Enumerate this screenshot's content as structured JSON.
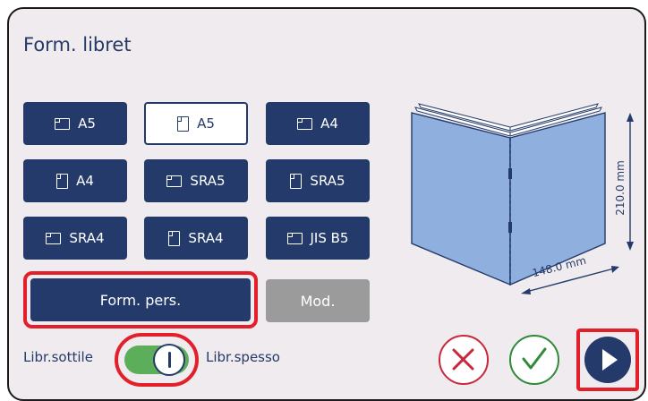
{
  "title": "Form. libret",
  "formats": [
    {
      "label": "A5",
      "icon": "landscape-sheet-icon"
    },
    {
      "label": "A5",
      "icon": "portrait-sheet-icon",
      "selected": true
    },
    {
      "label": "A4",
      "icon": "landscape-sheet-icon"
    },
    {
      "label": "A4",
      "icon": "portrait-sheet-icon"
    },
    {
      "label": "SRA5",
      "icon": "landscape-sheet-icon"
    },
    {
      "label": "SRA5",
      "icon": "portrait-sheet-icon"
    },
    {
      "label": "SRA4",
      "icon": "landscape-sheet-icon"
    },
    {
      "label": "SRA4",
      "icon": "portrait-sheet-icon"
    },
    {
      "label": "JIS B5",
      "icon": "landscape-sheet-icon"
    }
  ],
  "custom_button": "Form. pers.",
  "modify_button": "Mod.",
  "preview": {
    "height_label": "210.0 mm",
    "width_label": "148.0 mm"
  },
  "toggle": {
    "left_label": "Libr.sottile",
    "right_label": "Libr.spesso",
    "state": "right"
  },
  "actions": {
    "cancel_icon": "close-icon",
    "confirm_icon": "check-icon",
    "start_icon": "play-icon"
  },
  "colors": {
    "primary": "#233a6a",
    "highlight": "#e3202a",
    "toggle_on": "#5dae5b",
    "disabled": "#9b9b9b",
    "background": "#efebef"
  }
}
